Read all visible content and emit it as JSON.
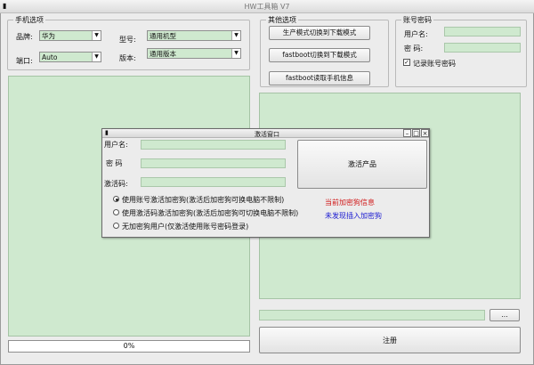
{
  "app": {
    "title": "HW工具箱 V7"
  },
  "phone_options": {
    "group_label": "手机选项",
    "brand_label": "品牌:",
    "brand_value": "华为",
    "model_label": "型号:",
    "model_value": "通用机型",
    "port_label": "端口:",
    "port_value": "Auto",
    "version_label": "版本:",
    "version_value": "通用版本"
  },
  "other_options": {
    "group_label": "其他选项",
    "btn_prod_to_download": "生产模式切换到下载模式",
    "btn_fastboot_to_download": "fastboot切换到下载模式",
    "btn_fastboot_read_info": "fastboot读取手机信息"
  },
  "account": {
    "group_label": "账号密码",
    "username_label": "用户名:",
    "password_label": "密  码:",
    "remember_label": "记录账号密码",
    "remember_checked": true
  },
  "bottom": {
    "progress_text": "0%",
    "progress_value": 0,
    "browse_label": "...",
    "register_label": "注册"
  },
  "activation_dialog": {
    "title": "激活窗口",
    "username_label": "用户名:",
    "password_label": "密  码",
    "activation_code_label": "激活码:",
    "activate_button": "激活产品",
    "radio_options": [
      "使用账号激活加密狗(激活后加密狗可换电脑不限制)",
      "使用激活码激活加密狗(激活后加密狗可切换电脑不限制)",
      "无加密狗用户(仅激活使用账号密码登录)"
    ],
    "radio_selected": 0,
    "status_current": "当前加密狗信息",
    "status_none": "未发现插入加密狗",
    "status_current_color": "#d11a1a",
    "status_none_color": "#1a1ad1"
  }
}
